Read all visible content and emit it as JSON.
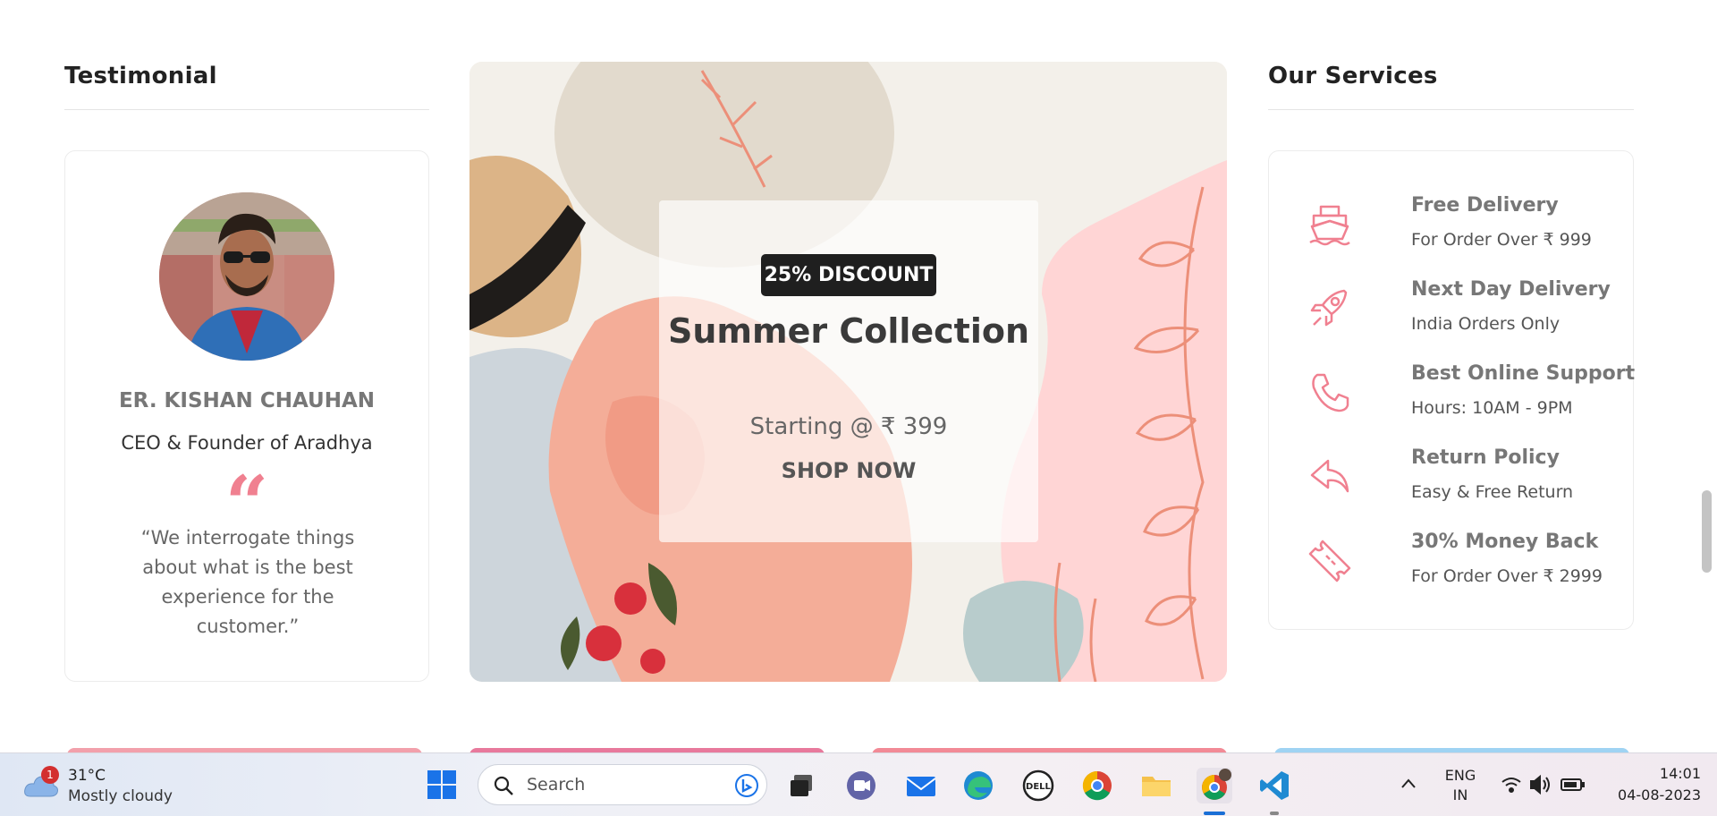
{
  "testimonial": {
    "heading": "Testimonial",
    "name": "ER. KISHAN CHAUHAN",
    "role": "CEO & Founder of Aradhya",
    "quote": "“We interrogate things about what is the best experience for the customer.”"
  },
  "banner": {
    "badge": "25% DISCOUNT",
    "title": "Summer Collection",
    "price": "Starting @ ₹ 399",
    "cta": "SHOP NOW"
  },
  "services": {
    "heading": "Our Services",
    "items": [
      {
        "icon": "ship-icon",
        "title": "Free Delivery",
        "subtitle": "For Order Over ₹ 999"
      },
      {
        "icon": "rocket-icon",
        "title": "Next Day Delivery",
        "subtitle": "India Orders Only"
      },
      {
        "icon": "phone-icon",
        "title": "Best Online Support",
        "subtitle": "Hours: 10AM - 9PM"
      },
      {
        "icon": "return-icon",
        "title": "Return Policy",
        "subtitle": "Easy & Free Return"
      },
      {
        "icon": "ticket-icon",
        "title": "30% Money Back",
        "subtitle": "For Order Over ₹ 2999"
      }
    ]
  },
  "colors": {
    "accent": "#f08090",
    "dark_badge": "#1f1f1f",
    "banner_pink": "#ffd5d5"
  },
  "taskbar": {
    "weather": {
      "badge": "1",
      "temp": "31°C",
      "condition": "Mostly cloudy"
    },
    "search_placeholder": "Search",
    "apps": [
      "windows-start",
      "search",
      "task-view",
      "teams-icon",
      "mail-icon",
      "edge-icon",
      "dell-icon",
      "chrome-icon",
      "file-explorer-icon",
      "chrome-profile-icon",
      "vscode-icon"
    ],
    "language": {
      "line1": "ENG",
      "line2": "IN"
    },
    "time": "14:01",
    "date": "04-08-2023"
  }
}
